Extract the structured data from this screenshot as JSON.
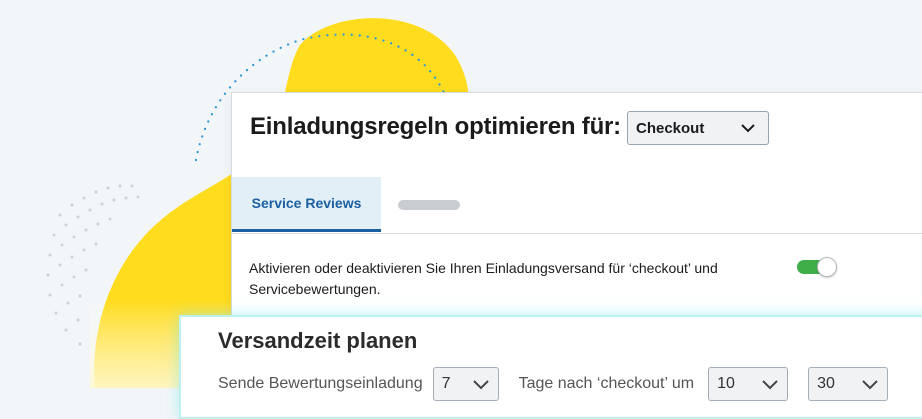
{
  "colors": {
    "blob_yellow": "#ffdc1e",
    "dot_blue": "#2b97d6",
    "accent_blue": "#1b5fa0",
    "tab_bg": "#e2eff7",
    "toggle_on": "#3fae49"
  },
  "header": {
    "title": "Einladungsregeln optimieren für:",
    "select_value": "Checkout",
    "select_icon": "chevron-down-icon"
  },
  "tabs": {
    "active_label": "Service Reviews"
  },
  "setting": {
    "description": "Aktivieren oder deaktivieren Sie Ihren Einladungsversand für ‘checkout’ und Servicebewertungen.",
    "toggle_enabled": true
  },
  "schedule": {
    "title": "Versandzeit planen",
    "prefix": "Sende Bewertungseinladung",
    "days_value": "7",
    "middle": "Tage nach ‘checkout’ um",
    "hour_value": "10",
    "minute_value": "30"
  }
}
